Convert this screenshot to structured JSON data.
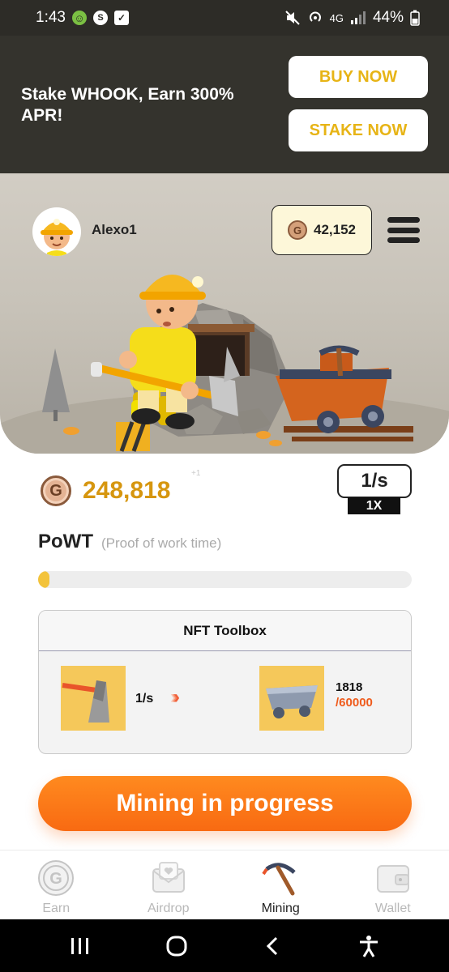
{
  "status_bar": {
    "time": "1:43",
    "network": "4G",
    "battery": "44%"
  },
  "promo": {
    "text": "Stake WHOOK, Earn 300% APR!",
    "buy_label": "BUY NOW",
    "stake_label": "STAKE NOW"
  },
  "profile": {
    "username": "Alexo1",
    "balance": "42,152"
  },
  "mining": {
    "total": "248,818",
    "increment": "+1",
    "rate": "1/s",
    "multiplier": "1X",
    "powt_title": "PoWT",
    "powt_subtitle": "(Proof of work time)",
    "progress_fraction": 0.03
  },
  "toolbox": {
    "title": "NFT Toolbox",
    "tool_rate": "1/s",
    "capacity_current": "1818",
    "capacity_max": "/60000"
  },
  "mining_button": {
    "label": "Mining in progress"
  },
  "tabs": [
    {
      "label": "Earn",
      "icon": "coin-icon",
      "active": false
    },
    {
      "label": "Airdrop",
      "icon": "envelope-heart-icon",
      "active": false
    },
    {
      "label": "Mining",
      "icon": "pickaxe-icon",
      "active": true
    },
    {
      "label": "Wallet",
      "icon": "wallet-icon",
      "active": false
    }
  ],
  "colors": {
    "accent_orange": "#f86a12",
    "gold_text": "#d6960f",
    "promo_bg": "#34332d",
    "progress_fill": "#f3c33b"
  }
}
